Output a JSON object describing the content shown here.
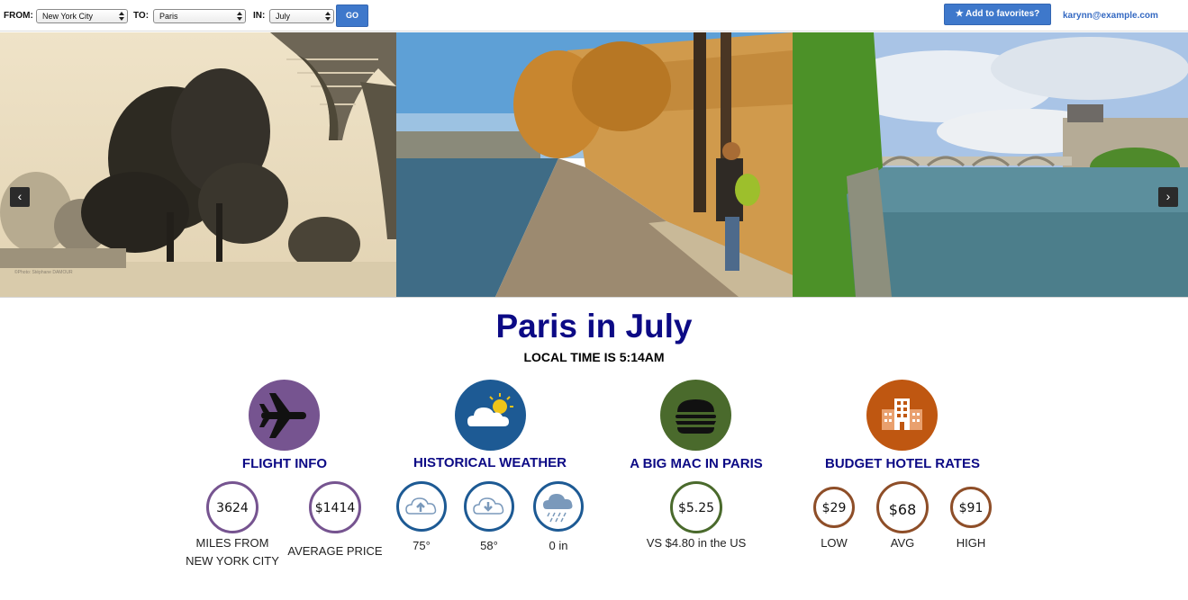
{
  "search": {
    "from_label": "FROM:",
    "from_value": "New York City",
    "to_label": "TO:",
    "to_value": "Paris",
    "in_label": "IN:",
    "in_value": "July",
    "go_label": "GO"
  },
  "header": {
    "favorites_label": "★ Add to favorites?",
    "user_email": "karynn@example.com"
  },
  "carousel": {
    "prev_label": "‹",
    "next_label": "›",
    "photo_credit": "©Photo: Stéphane DAMOUR"
  },
  "headline": {
    "title": "Paris in July",
    "local_time": "LOCAL TIME IS 5:14AM"
  },
  "colors": {
    "flight": "#765490",
    "weather": "#1d5a94",
    "bigmac": "#4a6a2c",
    "hotel": "#bf5711",
    "heading": "#0c0a85",
    "button": "#3e78cb"
  },
  "flight": {
    "icon": "airplane-icon",
    "title": "FLIGHT INFO",
    "miles_value": "3624",
    "miles_caption_1": "MILES FROM",
    "miles_caption_2": "NEW YORK CITY",
    "price_value": "$1414",
    "price_caption": "AVERAGE PRICE"
  },
  "weather": {
    "icon": "cloud-sun-icon",
    "title": "HISTORICAL WEATHER",
    "high_icon": "cloud-upload-icon",
    "high_value": "75°",
    "low_icon": "cloud-download-icon",
    "low_value": "58°",
    "precip_icon": "rain-cloud-icon",
    "precip_value": "0 in"
  },
  "bigmac": {
    "icon": "burger-icon",
    "title": "A BIG MAC IN PARIS",
    "price_value": "$5.25",
    "compare_caption": "VS $4.80 in the US"
  },
  "hotel": {
    "icon": "building-icon",
    "title": "BUDGET HOTEL RATES",
    "low_value": "$29",
    "low_caption": "LOW",
    "avg_value": "$68",
    "avg_caption": "AVG",
    "high_value": "$91",
    "high_caption": "HIGH"
  }
}
